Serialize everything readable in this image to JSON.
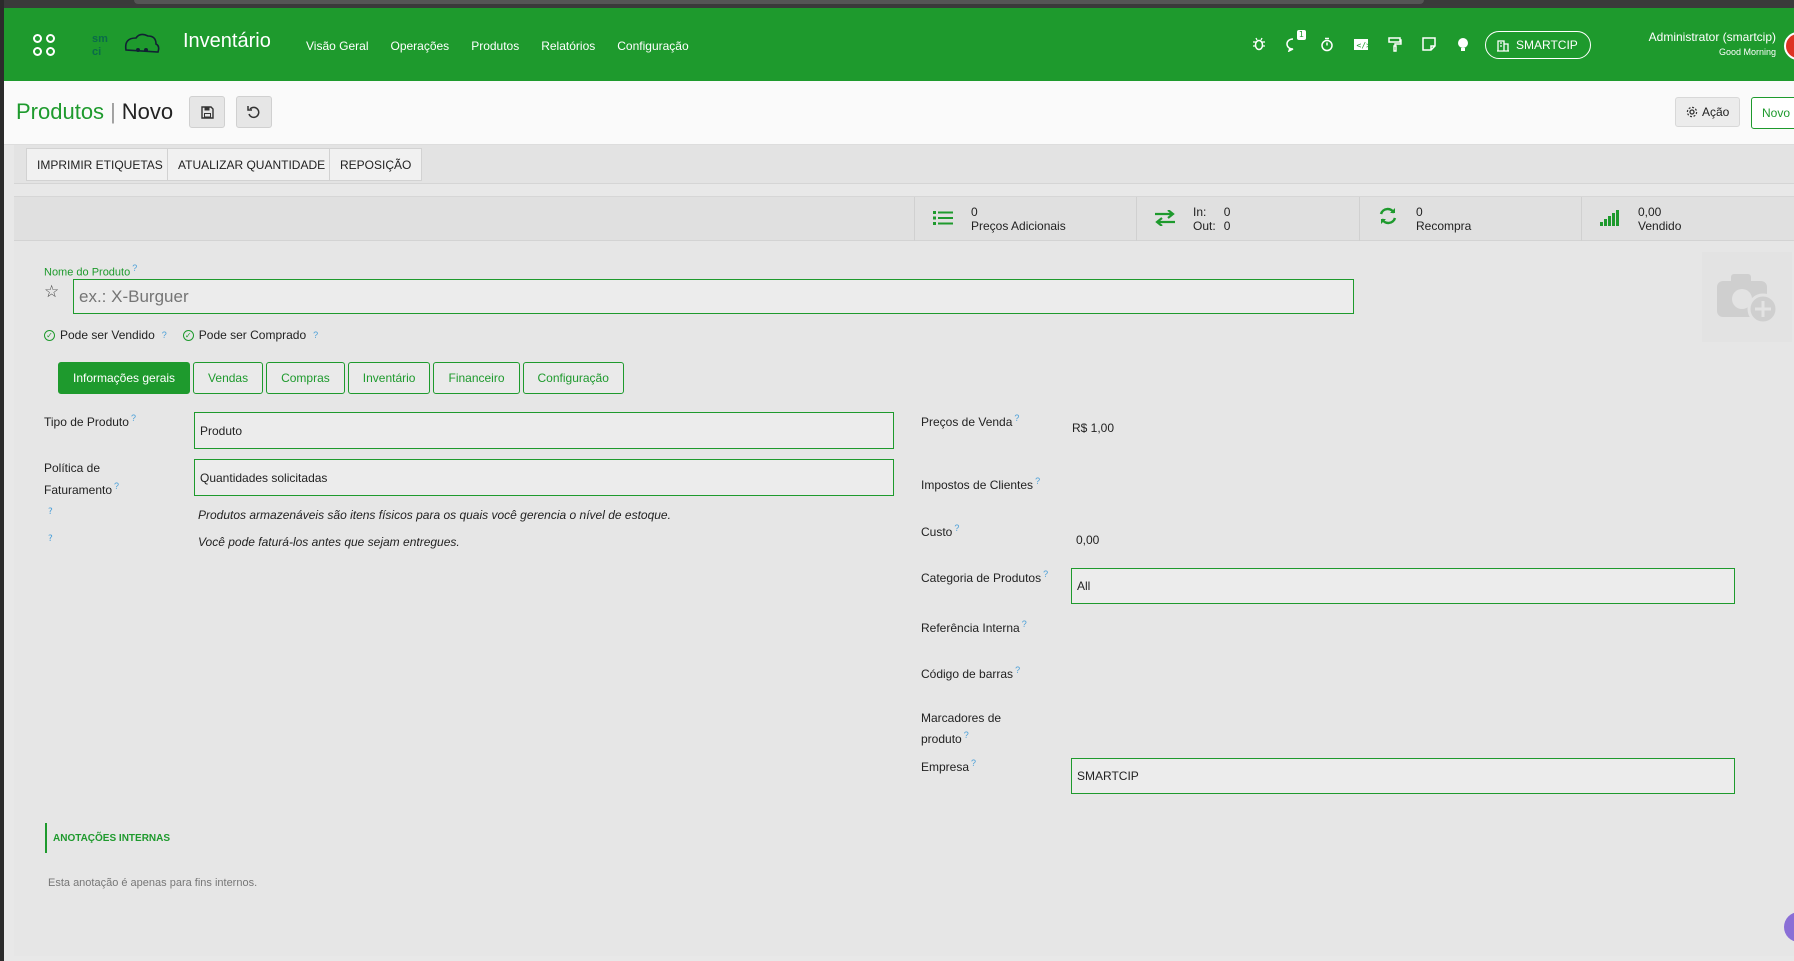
{
  "navbar": {
    "app_name": "Inventário",
    "logo_text": "smart cip",
    "menu": [
      "Visão Geral",
      "Operações",
      "Produtos",
      "Relatórios",
      "Configuração"
    ],
    "chat_badge": "1",
    "company": "SMARTCIP",
    "user_name": "Administrator (smartcip)",
    "greeting": "Good Morning"
  },
  "control_panel": {
    "breadcrumb_parent": "Produtos",
    "breadcrumb_current": "Novo",
    "action_label": "Ação",
    "new_label": "Novo"
  },
  "statusbar": {
    "buttons": [
      "IMPRIMIR ETIQUETAS",
      "ATUALIZAR QUANTIDADE",
      "REPOSIÇÃO"
    ]
  },
  "smart_buttons": {
    "prices": {
      "value": "0",
      "label": "Preços Adicionais"
    },
    "moves": {
      "in_label": "In:",
      "in_value": "0",
      "out_label": "Out:",
      "out_value": "0"
    },
    "rebuy": {
      "value": "0",
      "label": "Recompra"
    },
    "sold": {
      "value": "0,00",
      "label": "Vendido"
    }
  },
  "form": {
    "name_label": "Nome do Produto",
    "name_placeholder": "ex.: X-Burguer",
    "can_be_sold": "Pode ser Vendido",
    "can_be_purchased": "Pode ser Comprado",
    "tabs": [
      "Informações gerais",
      "Vendas",
      "Compras",
      "Inventário",
      "Financeiro",
      "Configuração"
    ],
    "left": {
      "product_type_label": "Tipo de Produto",
      "product_type_value": "Produto",
      "invoice_policy_label_1": "Política de",
      "invoice_policy_label_2": "Faturamento",
      "invoice_policy_value": "Quantidades solicitadas",
      "help_1": "Produtos armazenáveis são itens físicos para os quais você gerencia o nível de estoque.",
      "help_2": "Você pode faturá-los antes que sejam entregues."
    },
    "right": {
      "sale_price_label": "Preços de Venda",
      "sale_price_value": "R$ 1,00",
      "customer_taxes_label": "Impostos de Clientes",
      "cost_label": "Custo",
      "cost_value": "0,00",
      "category_label": "Categoria de Produtos",
      "category_value": "All",
      "internal_ref_label": "Referência Interna",
      "barcode_label": "Código de barras",
      "tags_label_1": "Marcadores de",
      "tags_label_2": "produto",
      "company_label": "Empresa",
      "company_value": "SMARTCIP"
    },
    "help_mark": "?",
    "notes_title": "ANOTAÇÕES INTERNAS",
    "notes_placeholder": "Esta anotação é apenas para fins internos."
  },
  "colors": {
    "brand": "#1e9a2d",
    "help": "#4a9fd8"
  }
}
